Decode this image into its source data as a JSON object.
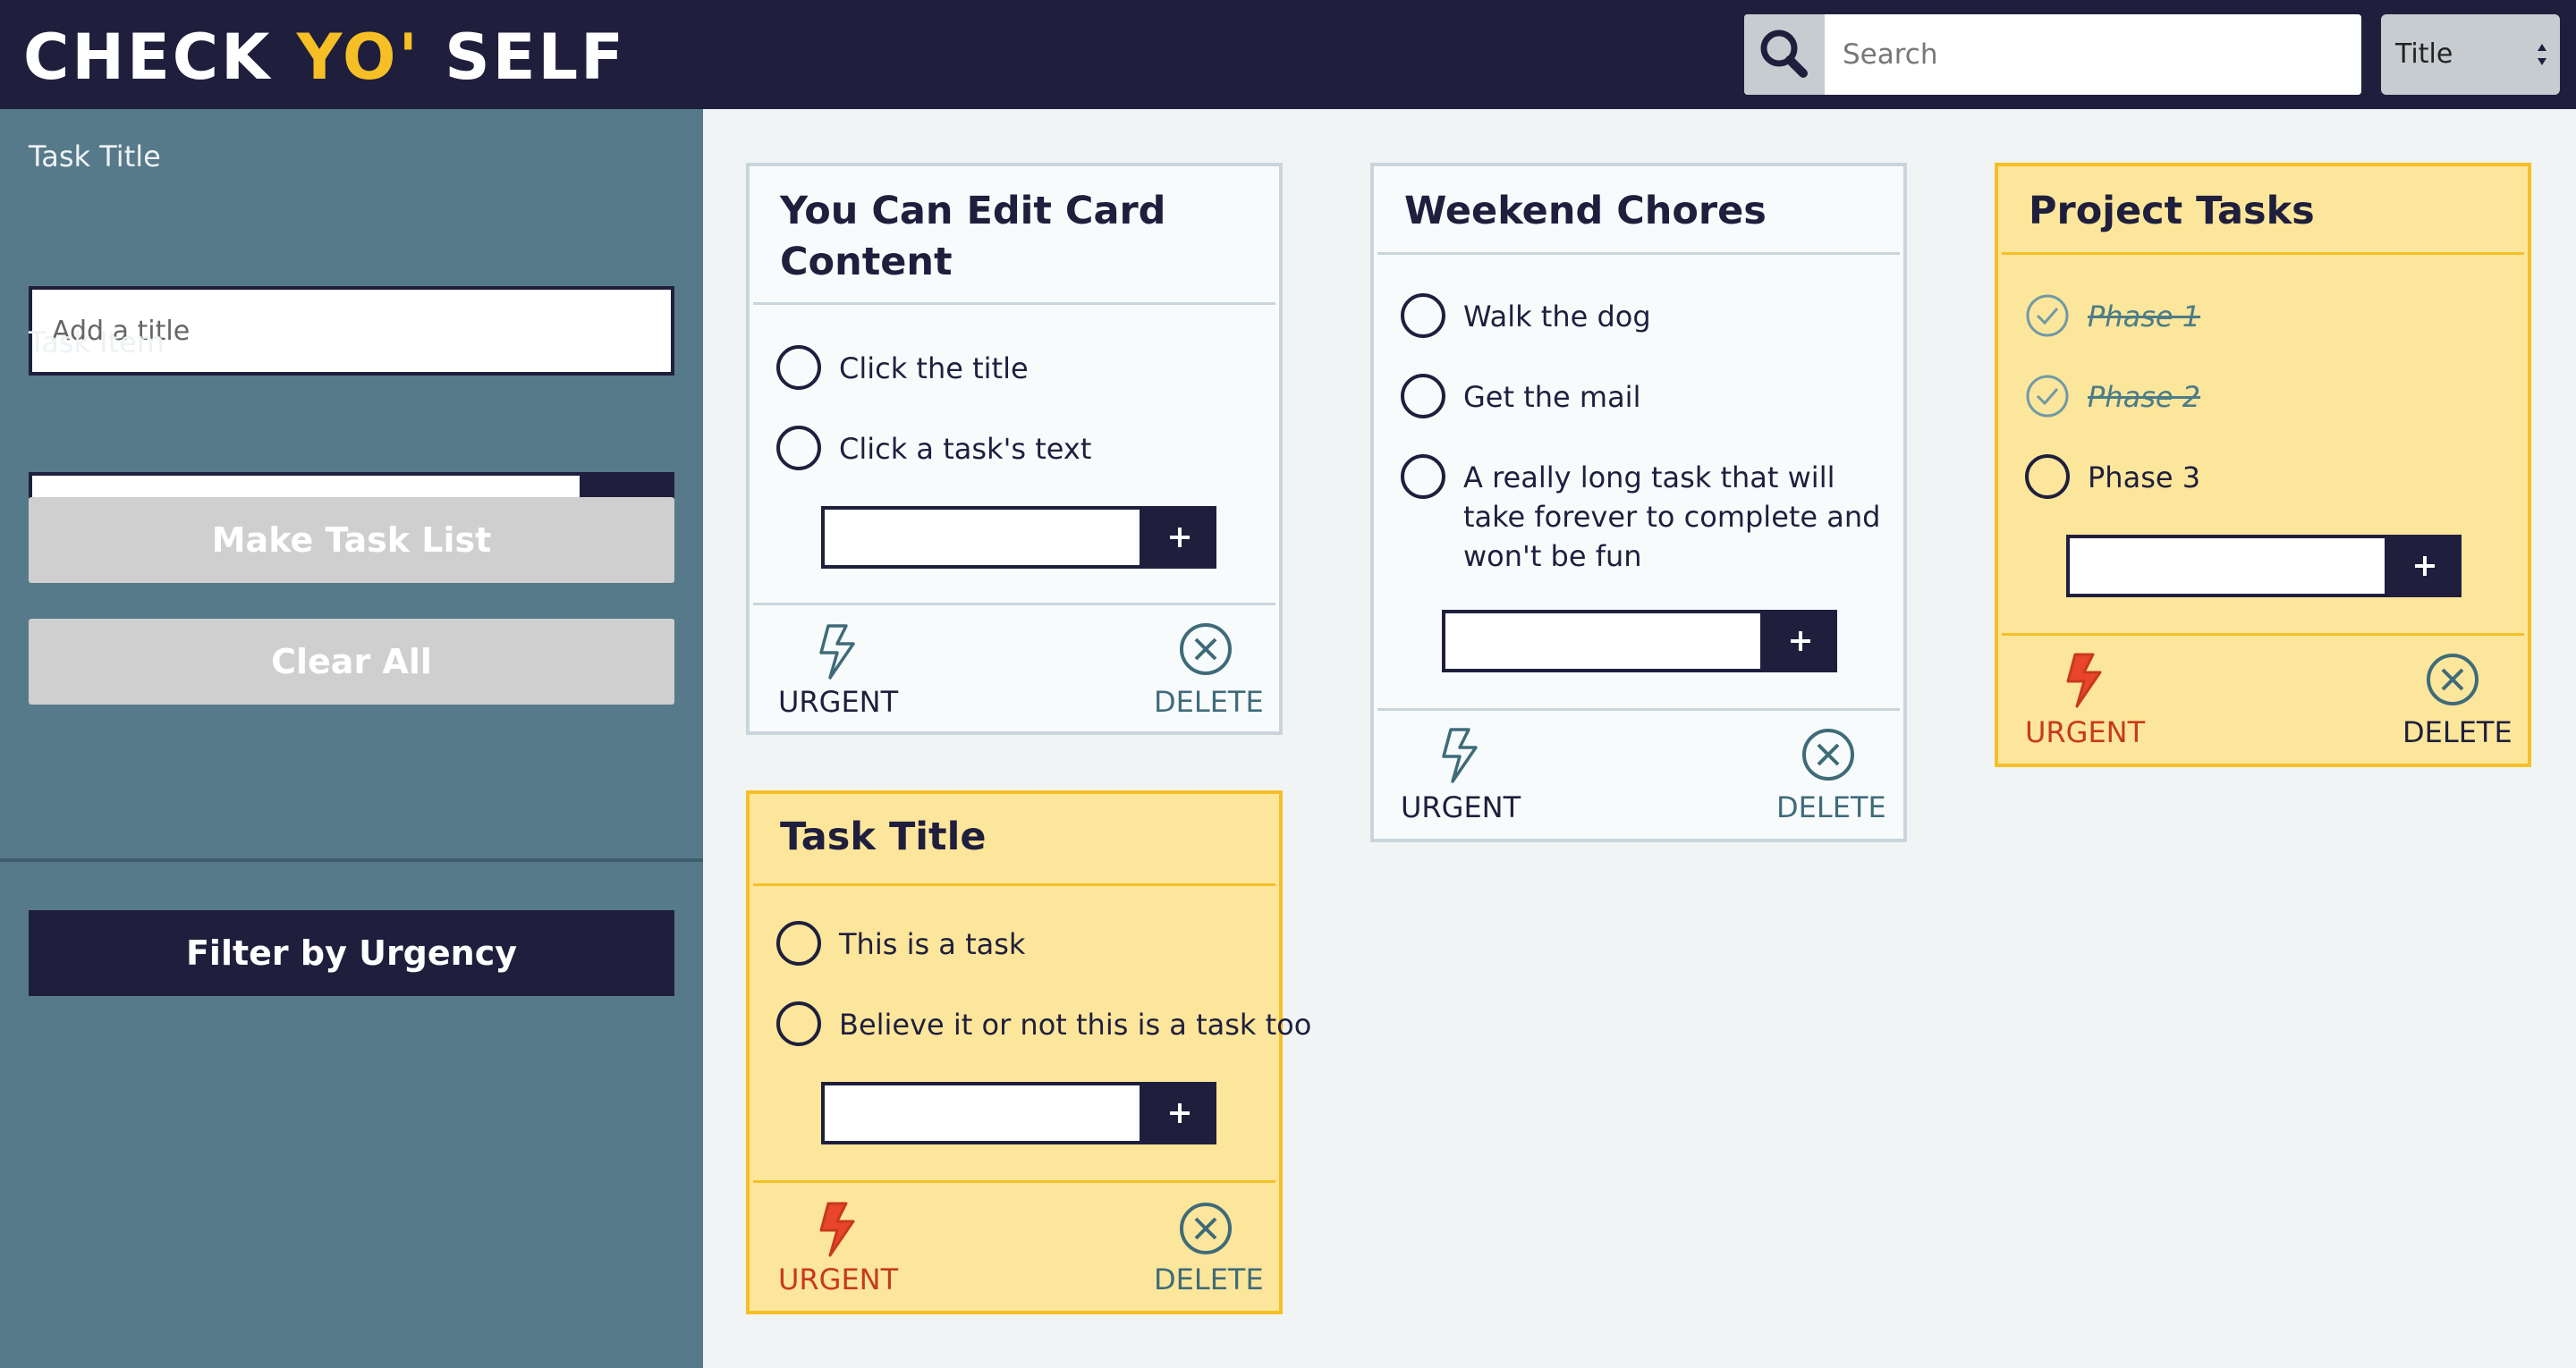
{
  "header": {
    "logo_part1": "CHECK ",
    "logo_part2": "YO'",
    "logo_part3": " SELF",
    "search_placeholder": "Search",
    "sort_value": "Title",
    "accent_color": "#f6bf26",
    "bg_color": "#1f1f3d"
  },
  "sidebar": {
    "title_label": "Task Title",
    "title_placeholder": "Add a title",
    "item_label": "Task Item",
    "make_button": "Make Task List",
    "clear_button": "Clear All",
    "filter_button": "Filter by Urgency",
    "bg_color": "#567a8a"
  },
  "cards": [
    {
      "title": "You Can Edit Card Content",
      "urgent": false,
      "tasks": [
        {
          "text": "Click the title",
          "done": false
        },
        {
          "text": "Click a task's text",
          "done": false
        }
      ],
      "urgent_label": "URGENT",
      "delete_label": "DELETE"
    },
    {
      "title": "Weekend Chores",
      "urgent": false,
      "tasks": [
        {
          "text": "Walk the dog",
          "done": false
        },
        {
          "text": "Get the mail",
          "done": false
        },
        {
          "text": "A really long task that will take forever to complete and won't be fun",
          "done": false
        }
      ],
      "urgent_label": "URGENT",
      "delete_label": "DELETE"
    },
    {
      "title": "Project Tasks",
      "urgent": true,
      "tasks": [
        {
          "text": "Phase 1",
          "done": true
        },
        {
          "text": "Phase 2",
          "done": true
        },
        {
          "text": "Phase 3",
          "done": false
        }
      ],
      "urgent_label": "URGENT",
      "delete_label": "DELETE"
    },
    {
      "title": "Task Title",
      "urgent": true,
      "tasks": [
        {
          "text": "This is a task",
          "done": false
        },
        {
          "text": "Believe it or not this is a task too",
          "done": false
        }
      ],
      "urgent_label": "URGENT",
      "delete_label": "DELETE"
    }
  ],
  "icons": {
    "search": "search-icon",
    "plus": "plus-icon",
    "urgent": "lightning-icon",
    "delete": "close-circle-icon",
    "checked": "check-circle-icon"
  }
}
